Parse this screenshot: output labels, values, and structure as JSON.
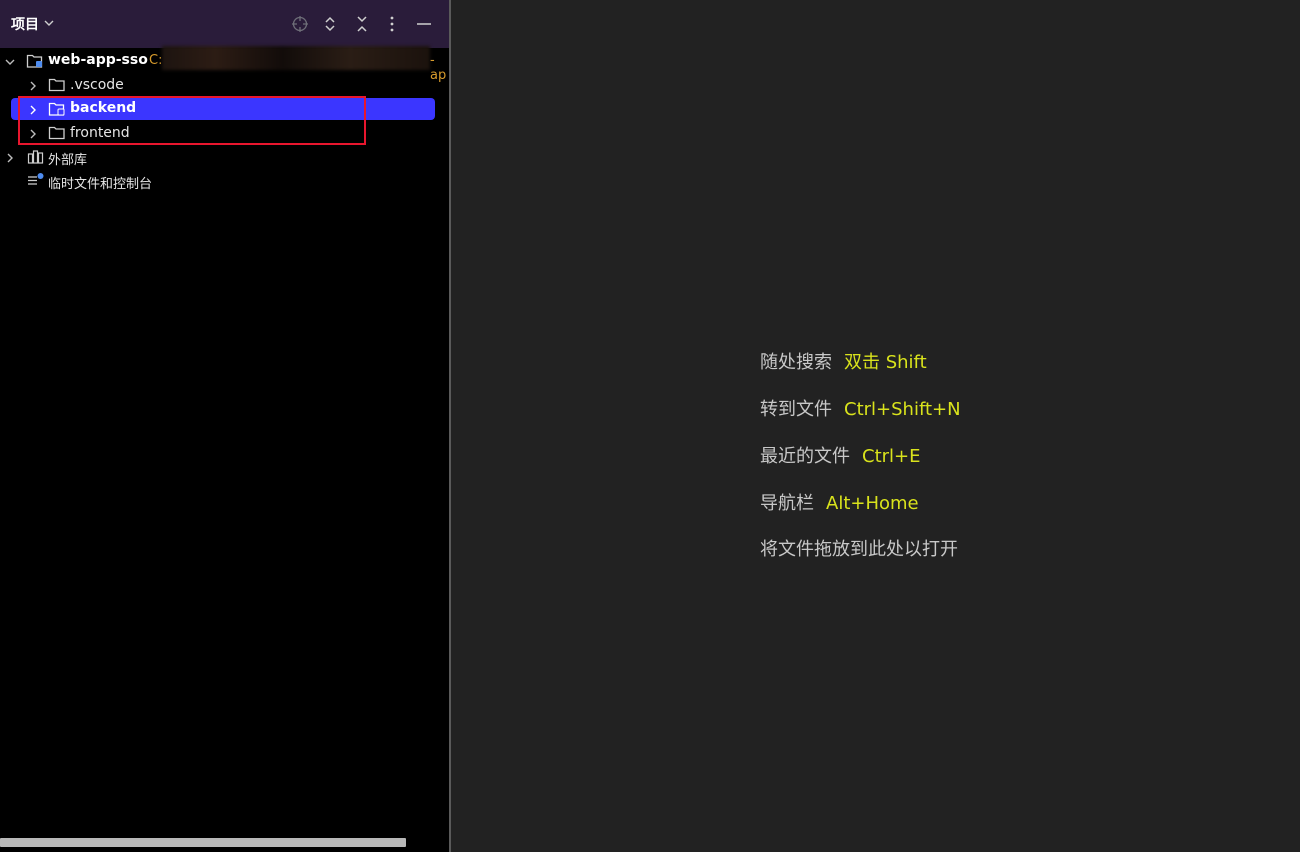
{
  "panel": {
    "title": "项目",
    "header_icons": [
      "locate-icon",
      "expand-all-icon",
      "collapse-all-icon",
      "more-options-icon",
      "minimize-icon"
    ]
  },
  "tree": {
    "root": {
      "label": "web-app-sso",
      "path_prefix": "C:",
      "path_suffix": "-ap"
    },
    "folders": [
      {
        "label": ".vscode",
        "selected": false
      },
      {
        "label": "backend",
        "selected": true
      },
      {
        "label": "frontend",
        "selected": false
      }
    ],
    "external_libraries": "外部库",
    "scratches": "临时文件和控制台"
  },
  "editor": {
    "hints": [
      {
        "label": "随处搜索",
        "shortcut": "双击 Shift"
      },
      {
        "label": "转到文件",
        "shortcut": "Ctrl+Shift+N"
      },
      {
        "label": "最近的文件",
        "shortcut": "Ctrl+E"
      },
      {
        "label": "导航栏",
        "shortcut": "Alt+Home"
      },
      {
        "label": "将文件拖放到此处以打开",
        "shortcut": ""
      }
    ]
  },
  "colors": {
    "header_bg": "#2a1c3a",
    "selection": "#3b36ff",
    "highlight_box": "#e8162e",
    "shortcut": "#d9e31c",
    "path_text": "#d79b2c"
  }
}
